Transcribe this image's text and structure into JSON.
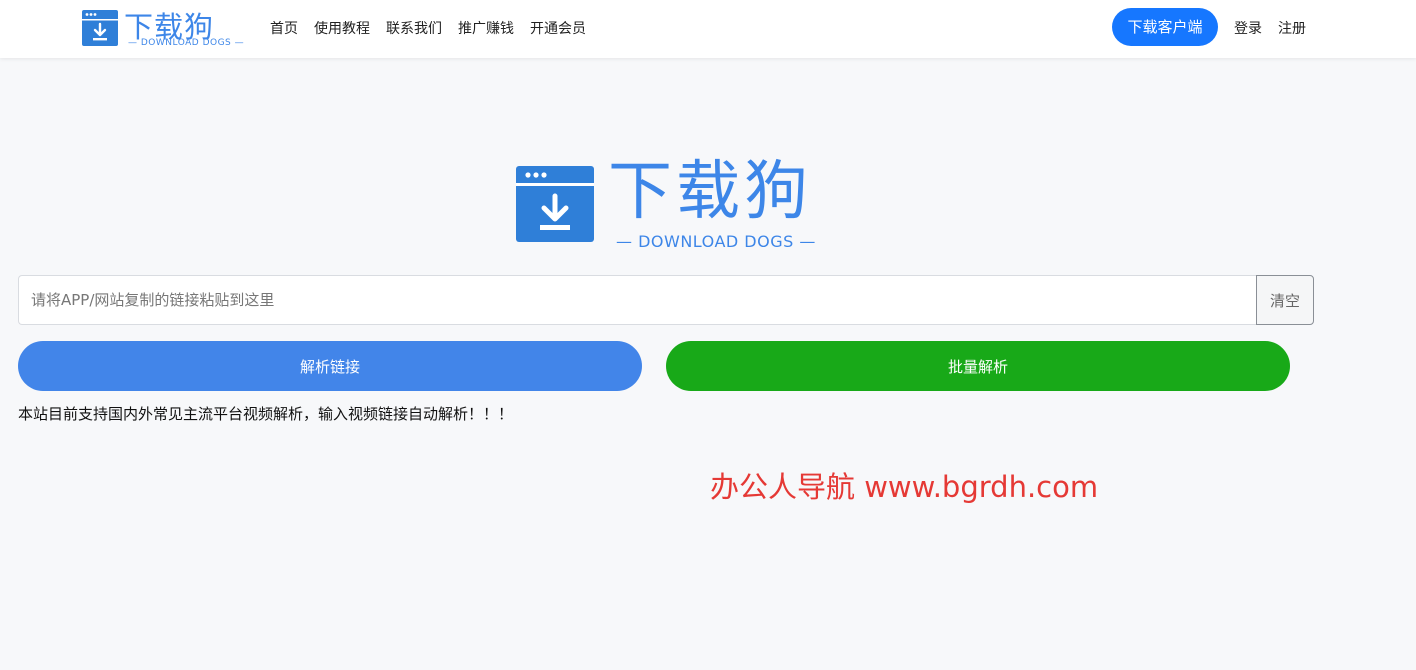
{
  "header": {
    "brand_title": "下载狗",
    "brand_sub": "— DOWNLOAD DOGS —",
    "nav": [
      "首页",
      "使用教程",
      "联系我们",
      "推广赚钱",
      "开通会员"
    ],
    "client_button": "下载客户端",
    "login": "登录",
    "register": "注册"
  },
  "hero": {
    "title": "下载狗",
    "subtitle": "— DOWNLOAD DOGS —"
  },
  "search": {
    "placeholder": "请将APP/网站复制的链接粘贴到这里",
    "value": "",
    "clear_label": "清空"
  },
  "actions": {
    "parse_label": "解析链接",
    "batch_label": "批量解析"
  },
  "notice": "本站目前支持国内外常见主流平台视频解析，输入视频链接自动解析！！！",
  "watermark": "办公人导航 www.bgrdh.com",
  "colors": {
    "brand_blue": "#3d86e8",
    "client_button": "#1677ff",
    "parse_button": "#4285e9",
    "batch_button": "#18a918",
    "watermark": "#e53935",
    "background": "#f7f8fa"
  },
  "icons": {
    "logo": "download-window-icon"
  }
}
